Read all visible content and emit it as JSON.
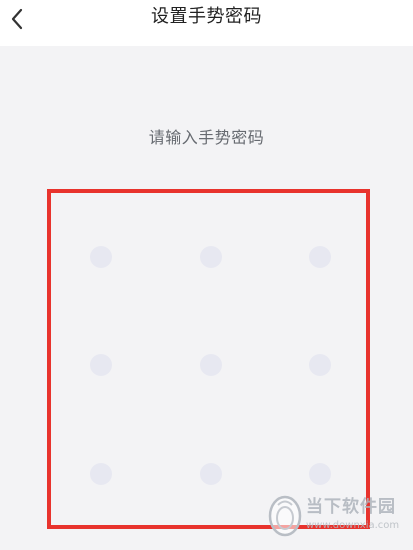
{
  "header": {
    "title": "设置手势密码",
    "back_icon": "chevron-left-icon"
  },
  "prompt": "请输入手势密码",
  "gesture_grid": {
    "rows": 3,
    "cols": 3,
    "dot_color": "#e7e8f1"
  },
  "highlight_color": "#e8332d",
  "watermark": {
    "name": "当下软件园",
    "url": "www.downxia.com"
  }
}
